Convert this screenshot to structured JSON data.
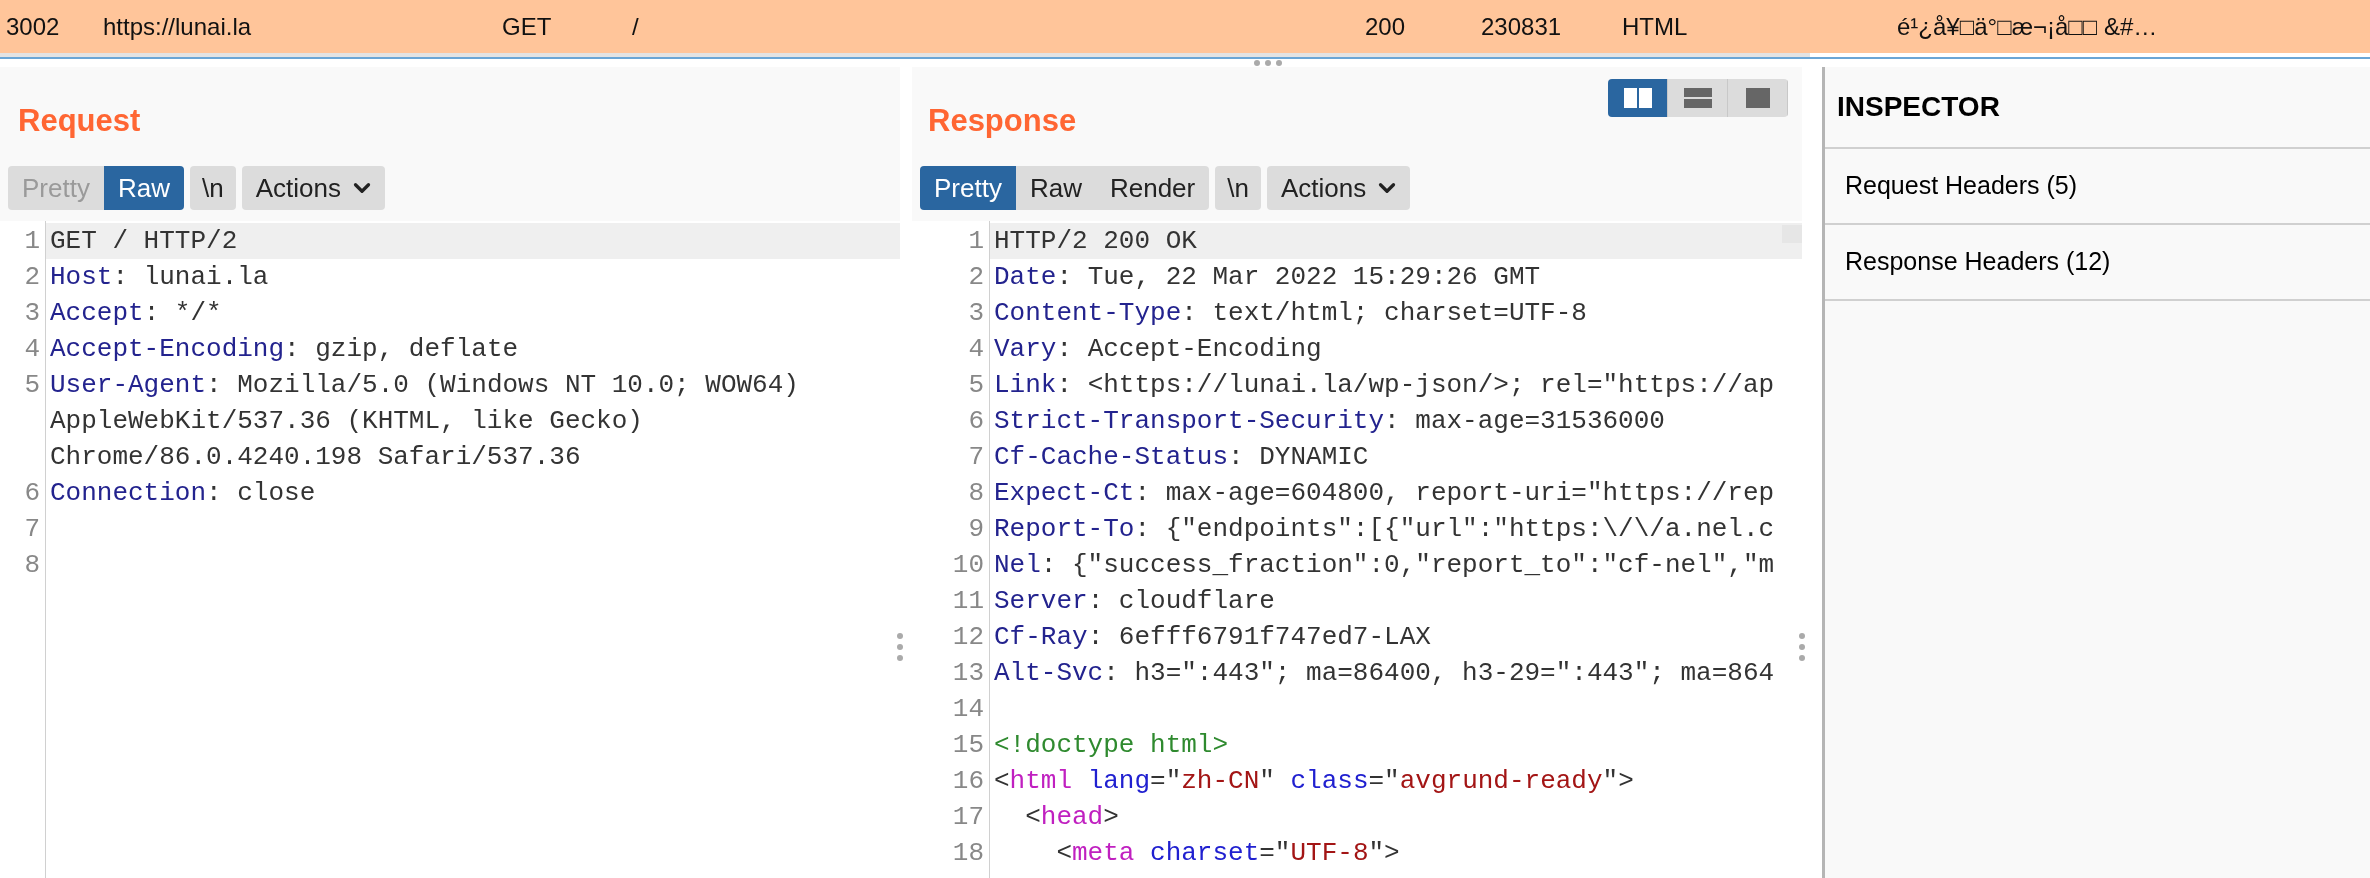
{
  "history_row": {
    "selected": true,
    "cells": [
      "3002",
      "https://lunai.la",
      "GET",
      "/",
      "200",
      "230831",
      "HTML",
      "é¹¿å¥□ä°□æ¬¡å□□ &#…"
    ]
  },
  "request": {
    "title": "Request",
    "tabs": [
      {
        "label": "Pretty",
        "selected": false,
        "disabled": true
      },
      {
        "label": "Raw",
        "selected": true,
        "disabled": false
      }
    ],
    "newline_button": "\\n",
    "actions_button": "Actions",
    "lines": [
      {
        "number": "1",
        "highlighted": true,
        "tokens": [
          {
            "kind": "plain",
            "text": "GET / HTTP/2"
          }
        ]
      },
      {
        "number": "2",
        "highlighted": false,
        "tokens": [
          {
            "kind": "key",
            "text": "Host"
          },
          {
            "kind": "plain",
            "text": ": lunai.la"
          }
        ]
      },
      {
        "number": "3",
        "highlighted": false,
        "tokens": [
          {
            "kind": "key",
            "text": "Accept"
          },
          {
            "kind": "plain",
            "text": ": */*"
          }
        ]
      },
      {
        "number": "4",
        "highlighted": false,
        "tokens": [
          {
            "kind": "key",
            "text": "Accept-Encoding"
          },
          {
            "kind": "plain",
            "text": ": gzip, deflate"
          }
        ]
      },
      {
        "number": "5",
        "highlighted": false,
        "tokens": [
          {
            "kind": "key",
            "text": "User-Agent"
          },
          {
            "kind": "plain",
            "text": ": Mozilla/5.0 (Windows NT 10.0; WOW64)"
          }
        ]
      },
      {
        "highlighted": false,
        "tokens": [
          {
            "kind": "plain",
            "text": "AppleWebKit/537.36 (KHTML, like Gecko)"
          }
        ]
      },
      {
        "highlighted": false,
        "tokens": [
          {
            "kind": "plain",
            "text": "Chrome/86.0.4240.198 Safari/537.36"
          }
        ]
      },
      {
        "number": "6",
        "highlighted": false,
        "tokens": [
          {
            "kind": "key",
            "text": "Connection"
          },
          {
            "kind": "plain",
            "text": ": close"
          }
        ]
      },
      {
        "number": "7",
        "highlighted": false
      },
      {
        "number": "8",
        "highlighted": false
      }
    ]
  },
  "response": {
    "title": "Response",
    "view_modes": [
      {
        "kind": "columns",
        "selected": true
      },
      {
        "kind": "rows",
        "selected": false
      },
      {
        "kind": "single",
        "selected": false
      }
    ],
    "tabs": [
      {
        "label": "Pretty",
        "selected": true,
        "disabled": false
      },
      {
        "label": "Raw",
        "selected": false,
        "disabled": false
      },
      {
        "label": "Render",
        "selected": false,
        "disabled": false
      }
    ],
    "newline_button": "\\n",
    "actions_button": "Actions",
    "lines": [
      {
        "number": "1",
        "highlighted": true,
        "tokens": [
          {
            "kind": "plain",
            "text": "HTTP/2 200 OK"
          }
        ]
      },
      {
        "number": "2",
        "highlighted": false,
        "tokens": [
          {
            "kind": "key",
            "text": "Date"
          },
          {
            "kind": "plain",
            "text": ": Tue, 22 Mar 2022 15:29:26 GMT"
          }
        ]
      },
      {
        "number": "3",
        "highlighted": false,
        "tokens": [
          {
            "kind": "key",
            "text": "Content-Type"
          },
          {
            "kind": "plain",
            "text": ": text/html; charset=UTF-8"
          }
        ]
      },
      {
        "number": "4",
        "highlighted": false,
        "tokens": [
          {
            "kind": "key",
            "text": "Vary"
          },
          {
            "kind": "plain",
            "text": ": Accept-Encoding"
          }
        ]
      },
      {
        "number": "5",
        "highlighted": false,
        "tokens": [
          {
            "kind": "key",
            "text": "Link"
          },
          {
            "kind": "plain",
            "text": ": <https://lunai.la/wp-json/>; rel=\"https://ap"
          }
        ]
      },
      {
        "number": "6",
        "highlighted": false,
        "tokens": [
          {
            "kind": "key",
            "text": "Strict-Transport-Security"
          },
          {
            "kind": "plain",
            "text": ": max-age=31536000"
          }
        ]
      },
      {
        "number": "7",
        "highlighted": false,
        "tokens": [
          {
            "kind": "key",
            "text": "Cf-Cache-Status"
          },
          {
            "kind": "plain",
            "text": ": DYNAMIC"
          }
        ]
      },
      {
        "number": "8",
        "highlighted": false,
        "tokens": [
          {
            "kind": "key",
            "text": "Expect-Ct"
          },
          {
            "kind": "plain",
            "text": ": max-age=604800, report-uri=\"https://rep"
          }
        ]
      },
      {
        "number": "9",
        "highlighted": false,
        "tokens": [
          {
            "kind": "key",
            "text": "Report-To"
          },
          {
            "kind": "plain",
            "text": ": {\"endpoints\":[{\"url\":\"https:\\/\\/a.nel.c"
          }
        ]
      },
      {
        "number": "10",
        "highlighted": false,
        "tokens": [
          {
            "kind": "key",
            "text": "Nel"
          },
          {
            "kind": "plain",
            "text": ": {\"success_fraction\":0,\"report_to\":\"cf-nel\",\"m"
          }
        ]
      },
      {
        "number": "11",
        "highlighted": false,
        "tokens": [
          {
            "kind": "key",
            "text": "Server"
          },
          {
            "kind": "plain",
            "text": ": cloudflare"
          }
        ]
      },
      {
        "number": "12",
        "highlighted": false,
        "tokens": [
          {
            "kind": "key",
            "text": "Cf-Ray"
          },
          {
            "kind": "plain",
            "text": ": 6efff6791f747ed7-LAX"
          }
        ]
      },
      {
        "number": "13",
        "highlighted": false,
        "tokens": [
          {
            "kind": "key",
            "text": "Alt-Svc"
          },
          {
            "kind": "plain",
            "text": ": h3=\":443\"; ma=86400, h3-29=\":443\"; ma=864"
          }
        ]
      },
      {
        "number": "14",
        "highlighted": false
      },
      {
        "number": "15",
        "highlighted": false,
        "tokens": [
          {
            "kind": "doctype",
            "text": "<!doctype html>"
          }
        ]
      },
      {
        "number": "16",
        "highlighted": false,
        "tokens": [
          {
            "kind": "plain",
            "text": "<"
          },
          {
            "kind": "tag",
            "text": "html"
          },
          {
            "kind": "attr",
            "text": " lang"
          },
          {
            "kind": "plain",
            "text": "=\""
          },
          {
            "kind": "value",
            "text": "zh-CN"
          },
          {
            "kind": "plain",
            "text": "\" "
          },
          {
            "kind": "attr",
            "text": "class"
          },
          {
            "kind": "plain",
            "text": "=\""
          },
          {
            "kind": "value",
            "text": "avgrund-ready"
          },
          {
            "kind": "plain",
            "text": "\">"
          }
        ]
      },
      {
        "number": "17",
        "highlighted": false,
        "tokens": [
          {
            "kind": "plain",
            "text": "  <"
          },
          {
            "kind": "tag",
            "text": "head"
          },
          {
            "kind": "plain",
            "text": ">"
          }
        ]
      },
      {
        "number": "18",
        "highlighted": false,
        "tokens": [
          {
            "kind": "plain",
            "text": "    <"
          },
          {
            "kind": "tag",
            "text": "meta"
          },
          {
            "kind": "attr",
            "text": " charset"
          },
          {
            "kind": "plain",
            "text": "=\""
          },
          {
            "kind": "value",
            "text": "UTF-8"
          },
          {
            "kind": "plain",
            "text": "\">"
          }
        ]
      }
    ]
  },
  "inspector": {
    "title": "INSPECTOR",
    "sections": [
      "Request Headers (5)",
      "Response Headers (12)"
    ]
  }
}
